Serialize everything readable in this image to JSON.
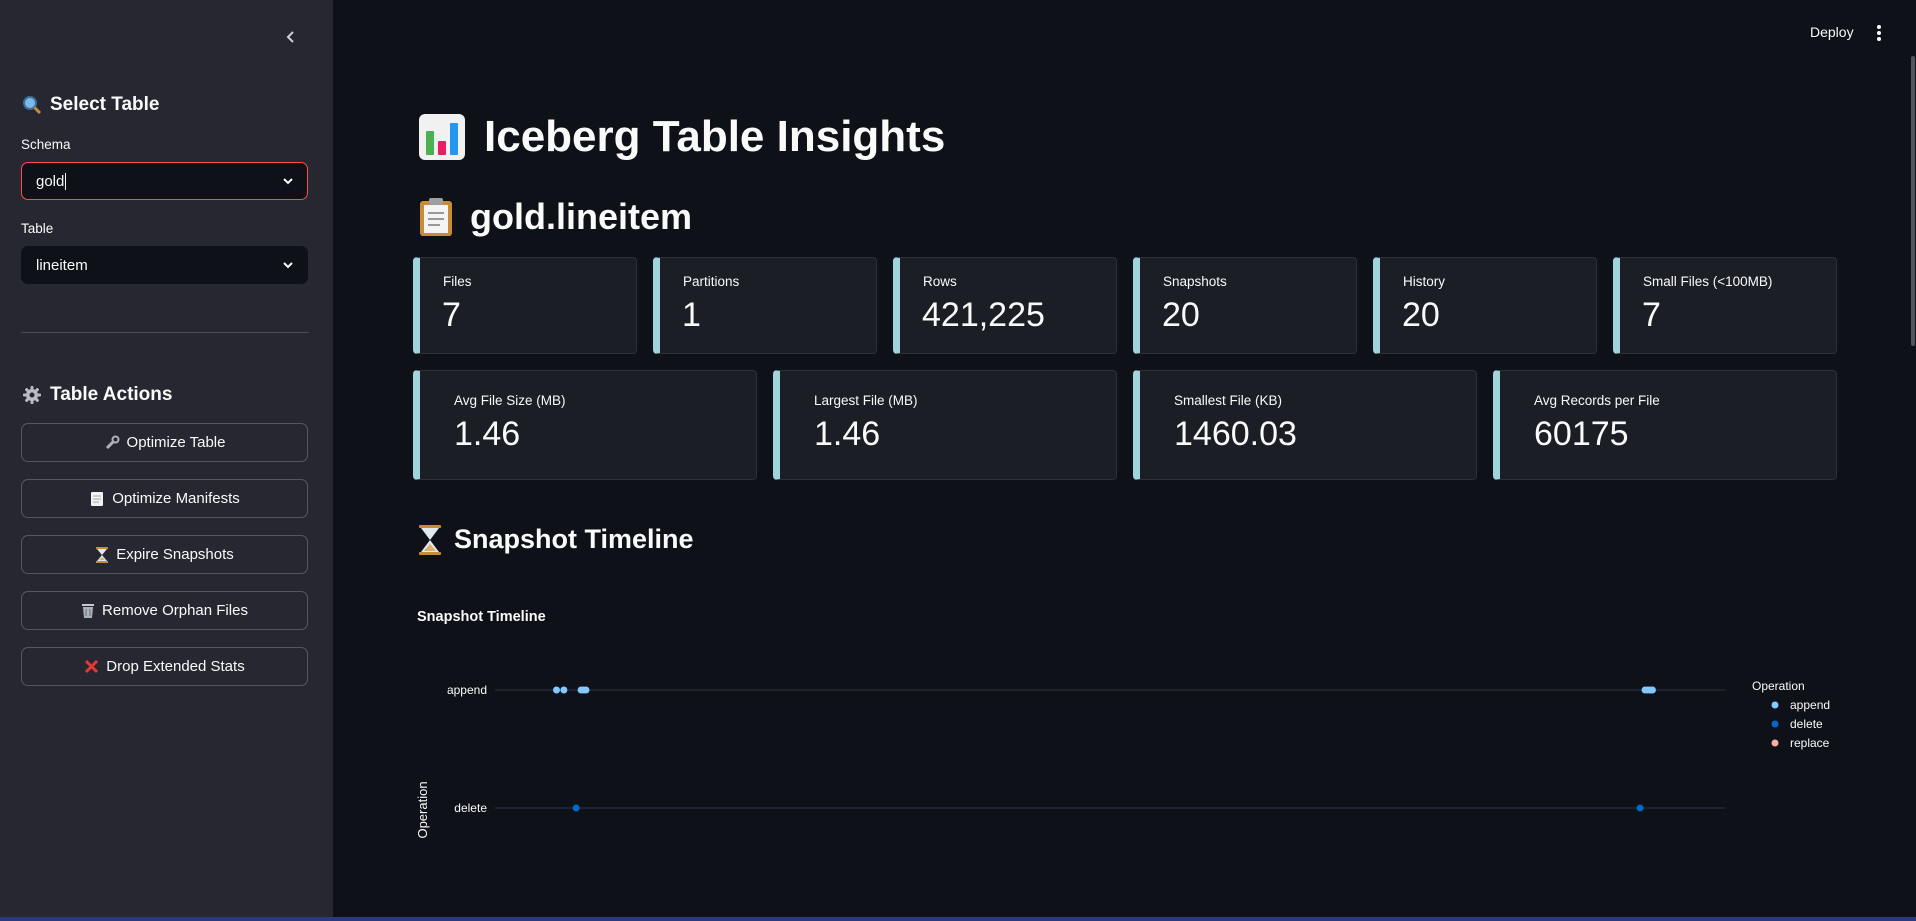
{
  "sidebar": {
    "select_heading": "Select Table",
    "schema_label": "Schema",
    "schema_value": "gold",
    "table_label": "Table",
    "table_value": "lineitem",
    "actions_heading": "Table Actions",
    "actions": [
      {
        "label": "Optimize Table",
        "icon": "wrench-icon"
      },
      {
        "label": "Optimize Manifests",
        "icon": "memo-icon"
      },
      {
        "label": "Expire Snapshots",
        "icon": "hourglass-icon"
      },
      {
        "label": "Remove Orphan Files",
        "icon": "wastebasket-icon"
      },
      {
        "label": "Drop Extended Stats",
        "icon": "cross-mark-icon"
      }
    ]
  },
  "header": {
    "deploy_label": "Deploy"
  },
  "main": {
    "title": "Iceberg Table Insights",
    "table_name": "gold.lineitem",
    "metrics_row1": [
      {
        "label": "Files",
        "value": "7"
      },
      {
        "label": "Partitions",
        "value": "1"
      },
      {
        "label": "Rows",
        "value": "421,225"
      },
      {
        "label": "Snapshots",
        "value": "20"
      },
      {
        "label": "History",
        "value": "20"
      },
      {
        "label": "Small Files (<100MB)",
        "value": "7"
      }
    ],
    "metrics_row2": [
      {
        "label": "Avg File Size (MB)",
        "value": "1.46"
      },
      {
        "label": "Largest File (MB)",
        "value": "1.46"
      },
      {
        "label": "Smallest File (KB)",
        "value": "1460.03"
      },
      {
        "label": "Avg Records per File",
        "value": "60175"
      }
    ],
    "section_title": "Snapshot Timeline"
  },
  "colors": {
    "accent_red": "#ff4b4b",
    "metric_border": "#9fd4dd",
    "append": "#83c9ff",
    "delete": "#0068c9",
    "replace": "#ffabab"
  },
  "chart_data": {
    "type": "scatter",
    "title": "Snapshot Timeline",
    "ylabel": "Operation",
    "xlabel": "",
    "categories": [
      "append",
      "delete"
    ],
    "x_range": [
      0,
      1000
    ],
    "legend": {
      "title": "Operation",
      "placement": "right",
      "entries": [
        "append",
        "delete",
        "replace"
      ]
    },
    "series": [
      {
        "name": "append",
        "points": [
          {
            "x": 50,
            "y": "append"
          },
          {
            "x": 56,
            "y": "append"
          },
          {
            "x": 70,
            "y": "append"
          },
          {
            "x": 72,
            "y": "append"
          },
          {
            "x": 74,
            "y": "append"
          },
          {
            "x": 935,
            "y": "append"
          },
          {
            "x": 937,
            "y": "append"
          },
          {
            "x": 939,
            "y": "append"
          },
          {
            "x": 941,
            "y": "append"
          }
        ]
      },
      {
        "name": "delete",
        "points": [
          {
            "x": 66,
            "y": "delete"
          },
          {
            "x": 931,
            "y": "delete"
          }
        ]
      },
      {
        "name": "replace",
        "points": []
      }
    ]
  }
}
